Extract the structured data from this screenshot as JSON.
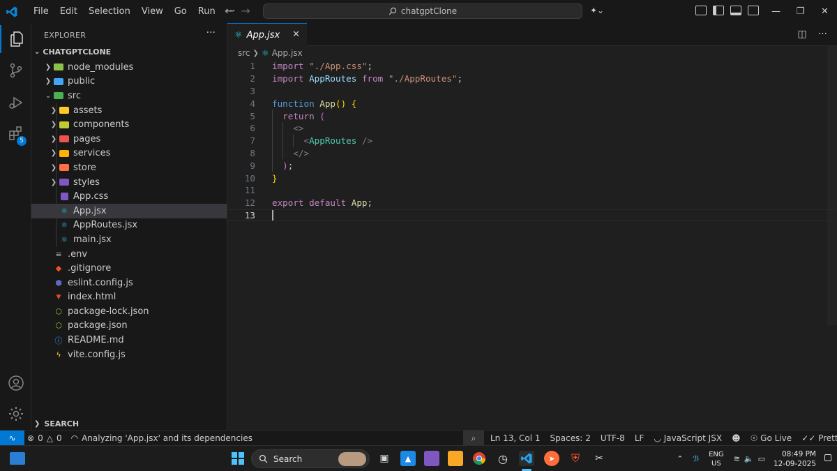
{
  "titlebar": {
    "menu": [
      "File",
      "Edit",
      "Selection",
      "View",
      "Go",
      "Run",
      "···"
    ],
    "search_text": "chatgptClone"
  },
  "activity": {
    "extensions_badge": "5"
  },
  "sidebar": {
    "title": "EXPLORER",
    "root": "CHATGPTCLONE",
    "search_section": "SEARCH",
    "tree": [
      {
        "label": "node_modules",
        "depth": 0,
        "kind": "folder",
        "color": "#8bc34a",
        "chevron": "right"
      },
      {
        "label": "public",
        "depth": 0,
        "kind": "folder",
        "color": "#42a5f5",
        "chevron": "right"
      },
      {
        "label": "src",
        "depth": 0,
        "kind": "folder-open",
        "color": "#4caf50",
        "chevron": "down"
      },
      {
        "label": "assets",
        "depth": 1,
        "kind": "folder",
        "color": "#ffca28",
        "chevron": "right"
      },
      {
        "label": "components",
        "depth": 1,
        "kind": "folder",
        "color": "#c0ca33",
        "chevron": "right"
      },
      {
        "label": "pages",
        "depth": 1,
        "kind": "folder",
        "color": "#ef5350",
        "chevron": "right"
      },
      {
        "label": "services",
        "depth": 1,
        "kind": "folder",
        "color": "#ffb300",
        "chevron": "right"
      },
      {
        "label": "store",
        "depth": 1,
        "kind": "folder",
        "color": "#ff7043",
        "chevron": "right"
      },
      {
        "label": "styles",
        "depth": 1,
        "kind": "folder",
        "color": "#7e57c2",
        "chevron": "right"
      },
      {
        "label": "App.css",
        "depth": 1,
        "kind": "css",
        "color": "#7e57c2",
        "chevron": ""
      },
      {
        "label": "App.jsx",
        "depth": 1,
        "kind": "react",
        "color": "#26c6da",
        "chevron": "",
        "selected": true
      },
      {
        "label": "AppRoutes.jsx",
        "depth": 1,
        "kind": "react",
        "color": "#26c6da",
        "chevron": ""
      },
      {
        "label": "main.jsx",
        "depth": 1,
        "kind": "react",
        "color": "#26c6da",
        "chevron": ""
      },
      {
        "label": ".env",
        "depth": 0,
        "kind": "env",
        "color": "#aaaaaa",
        "chevron": ""
      },
      {
        "label": ".gitignore",
        "depth": 0,
        "kind": "git",
        "color": "#f4511e",
        "chevron": ""
      },
      {
        "label": "eslint.config.js",
        "depth": 0,
        "kind": "eslint",
        "color": "#5c6bc0",
        "chevron": ""
      },
      {
        "label": "index.html",
        "depth": 0,
        "kind": "html",
        "color": "#e44d26",
        "chevron": ""
      },
      {
        "label": "package-lock.json",
        "depth": 0,
        "kind": "node",
        "color": "#8bc34a",
        "chevron": ""
      },
      {
        "label": "package.json",
        "depth": 0,
        "kind": "node",
        "color": "#8bc34a",
        "chevron": ""
      },
      {
        "label": "README.md",
        "depth": 0,
        "kind": "info",
        "color": "#42a5f5",
        "chevron": ""
      },
      {
        "label": "vite.config.js",
        "depth": 0,
        "kind": "vite",
        "color": "#ffca28",
        "chevron": ""
      }
    ]
  },
  "editor": {
    "tab_label": "App.jsx",
    "breadcrumb": [
      "src",
      "App.jsx"
    ],
    "current_line": 13,
    "lines": [
      [
        [
          "kw",
          "import"
        ],
        [
          "t",
          " "
        ],
        [
          "str",
          "\"./App.css\""
        ],
        [
          "t",
          ";"
        ]
      ],
      [
        [
          "kw",
          "import"
        ],
        [
          "t",
          " "
        ],
        [
          "id",
          "AppRoutes"
        ],
        [
          "t",
          " "
        ],
        [
          "kw",
          "from"
        ],
        [
          "t",
          " "
        ],
        [
          "str",
          "\"./AppRoutes\""
        ],
        [
          "t",
          ";"
        ]
      ],
      [],
      [
        [
          "kwb",
          "function"
        ],
        [
          "t",
          " "
        ],
        [
          "fn",
          "App"
        ],
        [
          "br1",
          "()"
        ],
        [
          "t",
          " "
        ],
        [
          "br1",
          "{"
        ]
      ],
      [
        [
          "t",
          "  "
        ],
        [
          "kw",
          "return"
        ],
        [
          "t",
          " "
        ],
        [
          "br2",
          "("
        ]
      ],
      [
        [
          "t",
          "    "
        ],
        [
          "tag",
          "<>"
        ]
      ],
      [
        [
          "t",
          "      "
        ],
        [
          "tag",
          "<"
        ],
        [
          "comp",
          "AppRoutes"
        ],
        [
          "t",
          " "
        ],
        [
          "tag",
          "/>"
        ]
      ],
      [
        [
          "t",
          "    "
        ],
        [
          "tag",
          "</>"
        ]
      ],
      [
        [
          "t",
          "  "
        ],
        [
          "br2",
          ")"
        ],
        [
          "t",
          ";"
        ]
      ],
      [
        [
          "br1",
          "}"
        ]
      ],
      [],
      [
        [
          "kw",
          "export"
        ],
        [
          "t",
          " "
        ],
        [
          "kw",
          "default"
        ],
        [
          "t",
          " "
        ],
        [
          "fn",
          "App"
        ],
        [
          "t",
          ";"
        ]
      ],
      []
    ]
  },
  "statusbar": {
    "errors": "0",
    "warnings": "0",
    "message": "Analyzing 'App.jsx' and its dependencies",
    "position": "Ln 13, Col 1",
    "spaces": "Spaces: 2",
    "encoding": "UTF-8",
    "eol": "LF",
    "language": "JavaScript JSX",
    "golive": "Go Live",
    "prettier": "Prettier"
  },
  "taskbar": {
    "search_label": "Search",
    "lang_top": "ENG",
    "lang_bottom": "US",
    "time": "08:49 PM",
    "date": "12-09-2025"
  }
}
